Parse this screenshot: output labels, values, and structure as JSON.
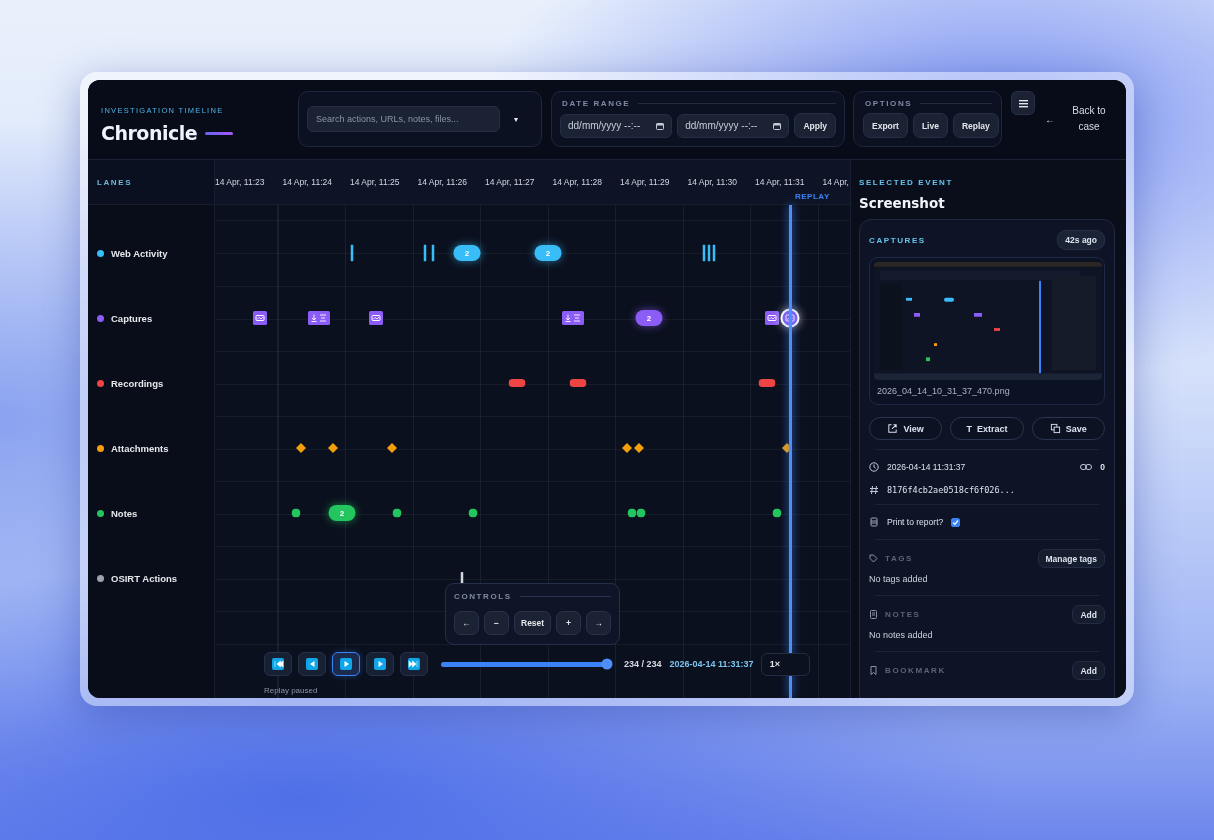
{
  "header": {
    "eyebrow": "INVESTIGATION TIMELINE",
    "title": "Chronicle",
    "search": {
      "placeholder": "Search actions, URLs, notes, files...",
      "dropdown": "▾"
    },
    "date_range": {
      "label": "DATE RANGE",
      "from": {
        "placeholder": "dd/mm/yyyy --:--"
      },
      "to": {
        "placeholder": "dd/mm/yyyy --:--"
      },
      "apply": "Apply"
    },
    "options": {
      "label": "OPTIONS",
      "buttons": [
        "Export",
        "Live",
        "Replay"
      ]
    },
    "back": {
      "arrow": "←",
      "label": "Back to case"
    }
  },
  "lanes_label": "LANES",
  "axis": [
    "14 Apr, 11:23",
    "14 Apr, 11:24",
    "14 Apr, 11:25",
    "14 Apr, 11:26",
    "14 Apr, 11:27",
    "14 Apr, 11:28",
    "14 Apr, 11:29",
    "14 Apr, 11:30",
    "14 Apr, 11:31",
    "14 Apr,"
  ],
  "replay_label": "REPLAY",
  "lanes": [
    {
      "name": "Web Activity",
      "color": "#38bdf8",
      "events": [
        {
          "kind": "tick",
          "selected": false
        },
        {
          "kind": "tick",
          "selected": false
        },
        {
          "kind": "tick",
          "selected": false
        },
        {
          "kind": "cluster",
          "count": "2",
          "selected": false
        },
        {
          "kind": "cluster",
          "count": "2",
          "selected": false
        },
        {
          "kind": "tick",
          "selected": false
        },
        {
          "kind": "tick",
          "selected": false
        },
        {
          "kind": "tick",
          "selected": false
        }
      ]
    },
    {
      "name": "Captures",
      "color": "#8b5cf6",
      "events": [
        {
          "kind": "capture",
          "selected": false
        },
        {
          "kind": "capture-pair",
          "selected": false
        },
        {
          "kind": "capture",
          "selected": false
        },
        {
          "kind": "capture-pair",
          "selected": false
        },
        {
          "kind": "cluster",
          "count": "2",
          "selected": false
        },
        {
          "kind": "capture",
          "selected": false
        },
        {
          "kind": "capture",
          "selected": true
        }
      ]
    },
    {
      "name": "Recordings",
      "color": "#ef4444",
      "events": [
        {
          "kind": "clip",
          "selected": false
        },
        {
          "kind": "clip",
          "selected": false
        },
        {
          "kind": "clip",
          "selected": false
        }
      ]
    },
    {
      "name": "Attachments",
      "color": "#f59e0b",
      "events": [
        {
          "kind": "diamond",
          "selected": false
        },
        {
          "kind": "diamond",
          "selected": false
        },
        {
          "kind": "diamond",
          "selected": false
        },
        {
          "kind": "diamond",
          "selected": false
        },
        {
          "kind": "diamond",
          "selected": false
        },
        {
          "kind": "diamond",
          "selected": false
        }
      ]
    },
    {
      "name": "Notes",
      "color": "#22c55e",
      "events": [
        {
          "kind": "dot",
          "selected": false
        },
        {
          "kind": "cluster",
          "count": "2",
          "selected": false
        },
        {
          "kind": "dot",
          "selected": false
        },
        {
          "kind": "dot",
          "selected": false
        },
        {
          "kind": "dot",
          "selected": false
        },
        {
          "kind": "dot",
          "selected": false
        },
        {
          "kind": "dot",
          "selected": false
        }
      ]
    },
    {
      "name": "OSIRT Actions",
      "color": "#9ca3af",
      "events": [
        {
          "kind": "tick",
          "selected": false
        }
      ]
    }
  ],
  "controls": {
    "title": "CONTROLS",
    "buttons": [
      "←",
      "−",
      "Reset",
      "+",
      "→"
    ]
  },
  "playback": {
    "buttons": [
      {
        "kind": "first",
        "selected": false
      },
      {
        "kind": "prev",
        "selected": false
      },
      {
        "kind": "play",
        "selected": true
      },
      {
        "kind": "next",
        "selected": false
      },
      {
        "kind": "last",
        "selected": false
      }
    ],
    "level": 1,
    "position": "234 / 234",
    "time": "2026-04-14 11:31:37",
    "speed": "1×",
    "status": "Replay paused"
  },
  "details": {
    "label": "SELECTED EVENT",
    "title": "Screenshot",
    "card": {
      "section": "CAPTURES",
      "age": "42s ago",
      "filename": "2026_04_14_10_31_37_470.png",
      "actions": [
        {
          "kind": "open",
          "label": "View"
        },
        {
          "kind": "text",
          "glyph": "T",
          "label": "Extract"
        },
        {
          "kind": "copy",
          "label": "Save"
        }
      ]
    },
    "timestamp": "2026-04-14 11:31:37",
    "links": "0",
    "hash": "8176f4cb2ae0518cf6f026...",
    "print": {
      "label": "Print to report?",
      "checked": true
    },
    "tags": {
      "label": "TAGS",
      "button": "Manage tags",
      "empty": "No tags added"
    },
    "notes": {
      "label": "NOTES",
      "button": "Add",
      "empty": "No notes added"
    },
    "bookmark": {
      "label": "BOOKMARK",
      "button": "Add"
    }
  }
}
